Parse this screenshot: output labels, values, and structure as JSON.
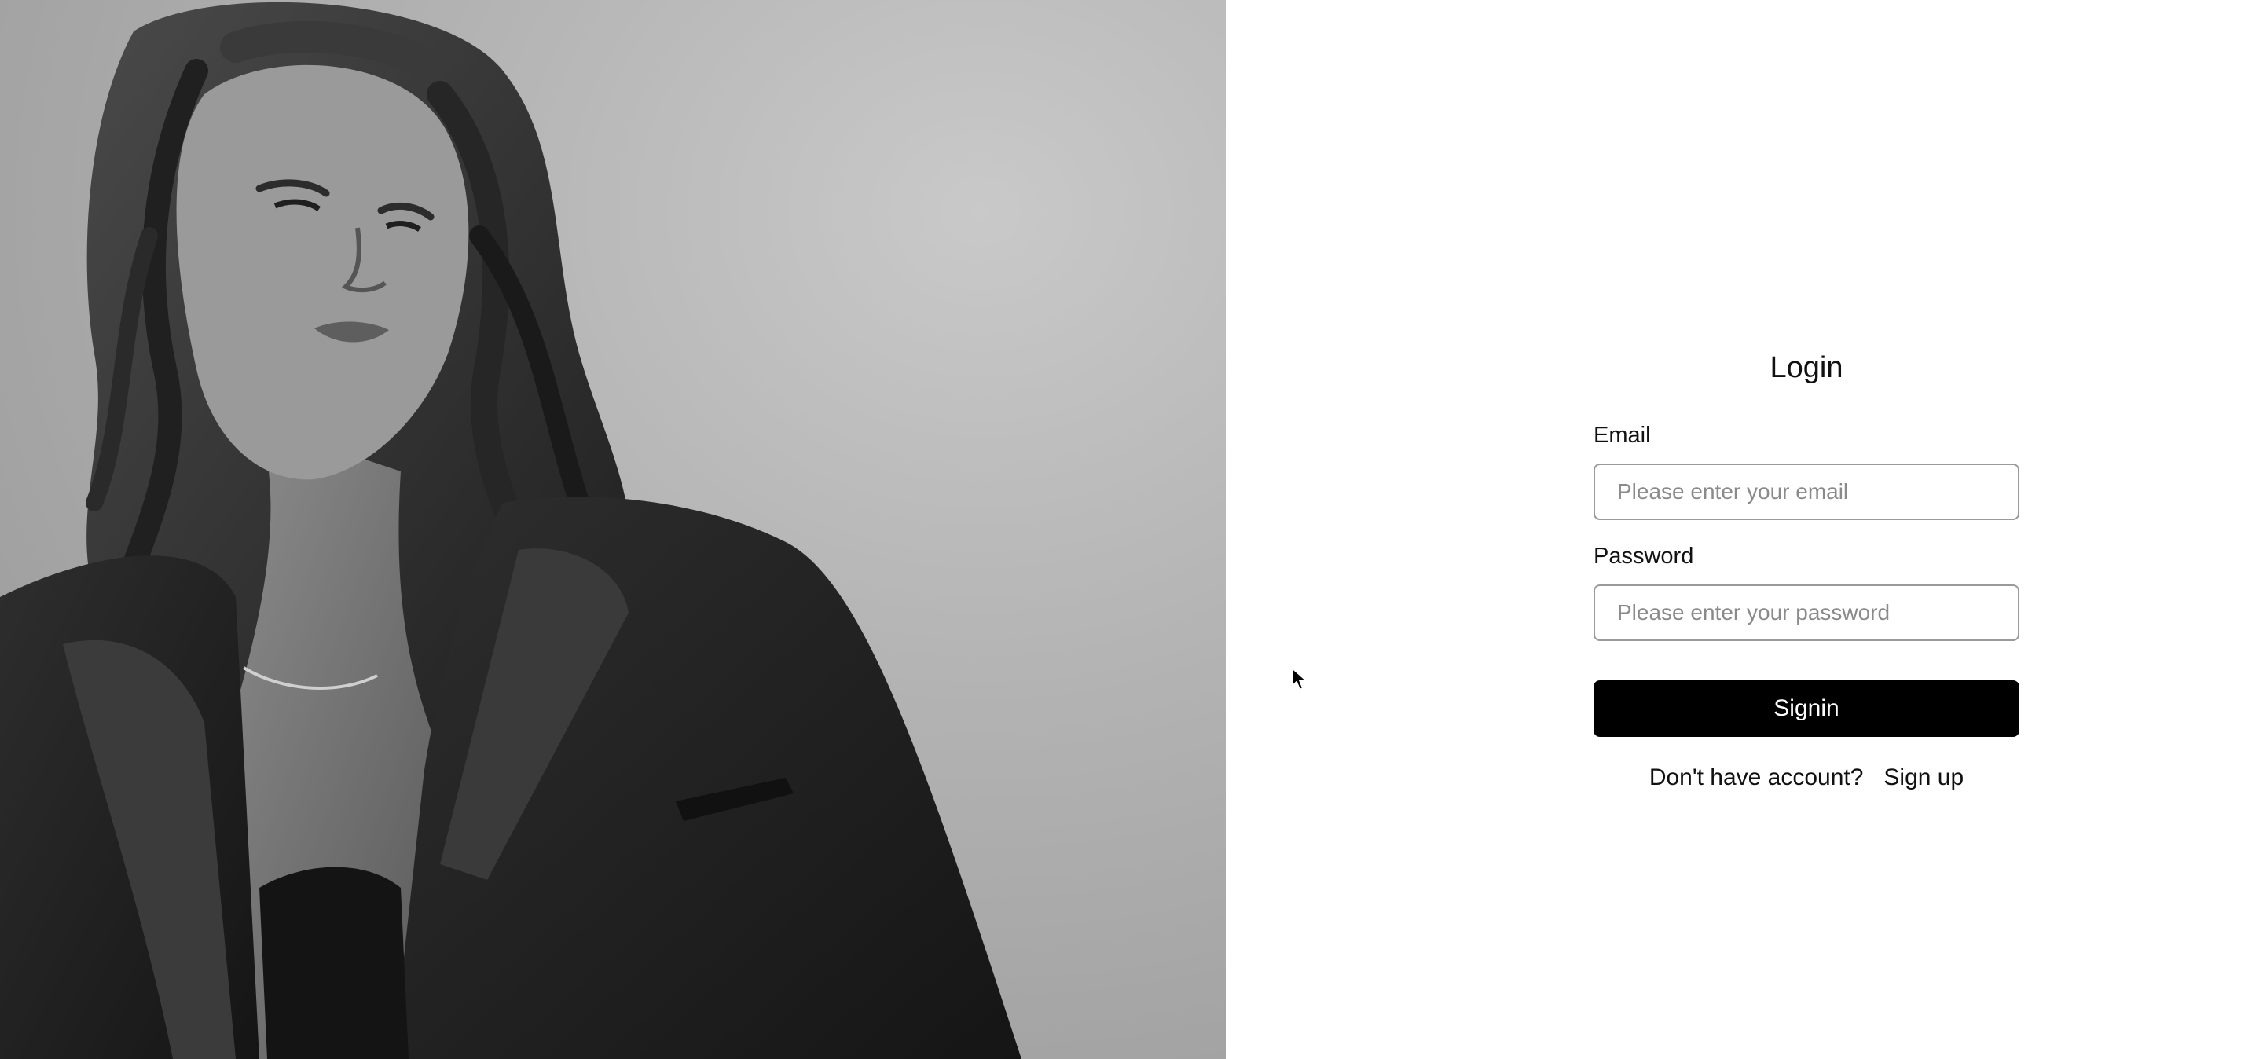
{
  "hero": {
    "icon": "portrait-photo"
  },
  "login": {
    "title": "Login",
    "email": {
      "label": "Email",
      "value": "",
      "placeholder": "Please enter your email"
    },
    "password": {
      "label": "Password",
      "value": "",
      "placeholder": "Please enter your password"
    },
    "signin_label": "Signin",
    "signup_prompt": "Don't have account?",
    "signup_link": "Sign up"
  },
  "colors": {
    "button_bg": "#000000",
    "button_text": "#ffffff",
    "input_border": "#9a9a9a",
    "placeholder": "#8a8a8a",
    "page_bg": "#ffffff"
  },
  "cursor": {
    "icon": "mouse-pointer-icon"
  }
}
